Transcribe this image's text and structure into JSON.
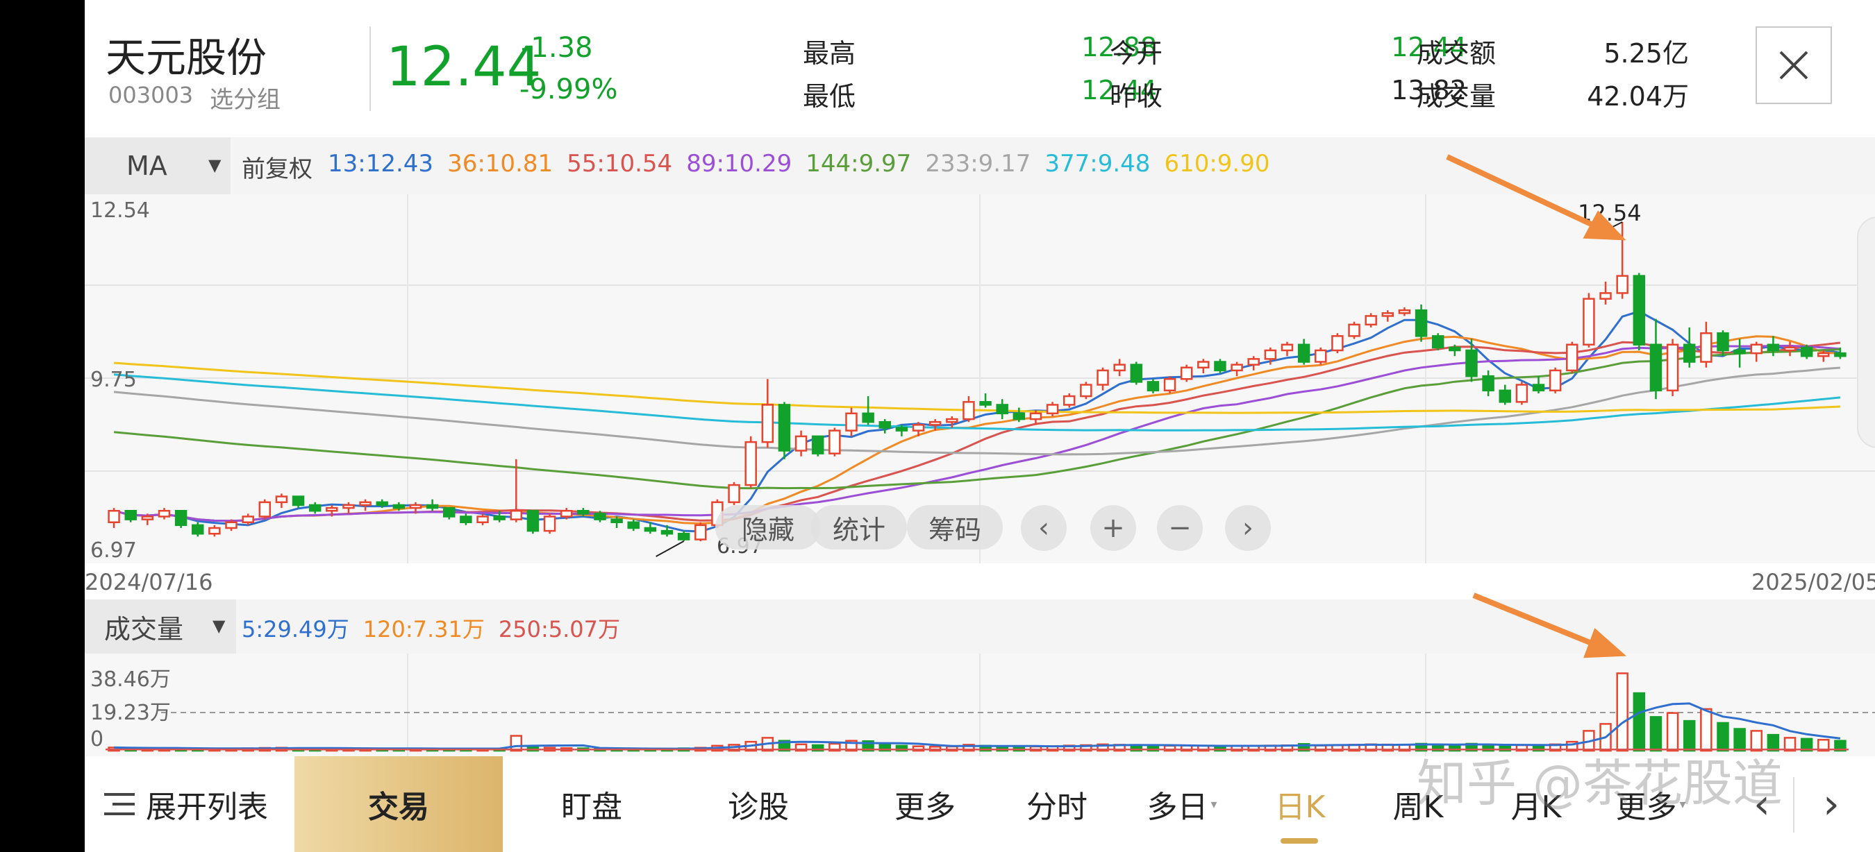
{
  "stock": {
    "name": "天元股份",
    "code": "003003",
    "group_label": "选分组",
    "price": "12.44",
    "change": "-1.38",
    "change_pct": "-9.99%"
  },
  "quote": {
    "high_label": "最高",
    "high": "12.88",
    "low_label": "最低",
    "low": "12.44",
    "open_label": "今开",
    "open": "12.44",
    "prev_close_label": "昨收",
    "prev_close": "13.82",
    "amount_label": "成交额",
    "amount": "5.25亿",
    "volume_label": "成交量",
    "volume": "42.04万"
  },
  "ma_bar": {
    "selector": "MA",
    "adjust": "前复权",
    "items": [
      {
        "text": "13:12.43",
        "color": "#2f6fce"
      },
      {
        "text": "36:10.81",
        "color": "#f08a24"
      },
      {
        "text": "55:10.54",
        "color": "#d9534f"
      },
      {
        "text": "89:10.29",
        "color": "#9b4fd6"
      },
      {
        "text": "144:9.97",
        "color": "#5a9e3a"
      },
      {
        "text": "233:9.17",
        "color": "#a6a6a6"
      },
      {
        "text": "377:9.48",
        "color": "#26bcd7"
      },
      {
        "text": "610:9.90",
        "color": "#f0c419"
      }
    ]
  },
  "price_chart": {
    "y_top": "12.54",
    "y_mid": "9.75",
    "y_bottom": "6.97",
    "max_marker": "12.54",
    "min_marker": "6.97",
    "date_start": "2024/07/16",
    "date_end": "2025/02/05"
  },
  "chart_buttons": {
    "hide": "隐藏",
    "stats": "统计",
    "chips": "筹码",
    "prev": "‹",
    "zoom_in": "+",
    "zoom_out": "−",
    "next": "›"
  },
  "volume_bar": {
    "selector": "成交量",
    "items": [
      {
        "text": "5:29.49万",
        "color": "#2f6fce"
      },
      {
        "text": "120:7.31万",
        "color": "#f08a24"
      },
      {
        "text": "250:5.07万",
        "color": "#d9534f"
      }
    ],
    "y_top": "38.46万",
    "y_mid": "19.23万",
    "y_zero": "0"
  },
  "bottom_bar": {
    "expand_list": "展开列表",
    "trade": "交易",
    "watch": "盯盘",
    "diagnose": "诊股",
    "more": "更多",
    "intraday": "分时",
    "multi_day": "多日",
    "daily_k": "日K",
    "weekly_k": "周K",
    "monthly_k": "月K",
    "more_periods": "更多"
  },
  "watermark": "知乎 @茶花股道",
  "colors": {
    "up": "#e6442e",
    "down": "#12a12a",
    "trade_gold": "#e2c27c",
    "annotation_arrow": "#f08a3c"
  },
  "chart_data": {
    "type": "candlestick",
    "note_source": "estimated from visible candles",
    "ohlc": [
      [
        7.3,
        7.55,
        7.2,
        7.5
      ],
      [
        7.5,
        7.5,
        7.3,
        7.35
      ],
      [
        7.35,
        7.45,
        7.25,
        7.4
      ],
      [
        7.4,
        7.55,
        7.35,
        7.5
      ],
      [
        7.5,
        7.5,
        7.2,
        7.25
      ],
      [
        7.25,
        7.3,
        7.05,
        7.1
      ],
      [
        7.1,
        7.25,
        7.05,
        7.2
      ],
      [
        7.2,
        7.35,
        7.15,
        7.3
      ],
      [
        7.3,
        7.45,
        7.25,
        7.4
      ],
      [
        7.4,
        7.7,
        7.35,
        7.65
      ],
      [
        7.65,
        7.8,
        7.55,
        7.75
      ],
      [
        7.75,
        7.75,
        7.55,
        7.6
      ],
      [
        7.6,
        7.65,
        7.45,
        7.5
      ],
      [
        7.5,
        7.6,
        7.4,
        7.55
      ],
      [
        7.55,
        7.65,
        7.45,
        7.6
      ],
      [
        7.6,
        7.7,
        7.5,
        7.65
      ],
      [
        7.65,
        7.7,
        7.55,
        7.6
      ],
      [
        7.6,
        7.65,
        7.5,
        7.55
      ],
      [
        7.55,
        7.65,
        7.45,
        7.6
      ],
      [
        7.6,
        7.7,
        7.5,
        7.55
      ],
      [
        7.55,
        7.55,
        7.35,
        7.4
      ],
      [
        7.4,
        7.45,
        7.25,
        7.3
      ],
      [
        7.3,
        7.45,
        7.25,
        7.4
      ],
      [
        7.4,
        7.5,
        7.3,
        7.35
      ],
      [
        7.35,
        8.4,
        7.3,
        7.5
      ],
      [
        7.5,
        7.5,
        7.1,
        7.15
      ],
      [
        7.15,
        7.45,
        7.1,
        7.4
      ],
      [
        7.4,
        7.55,
        7.35,
        7.5
      ],
      [
        7.5,
        7.55,
        7.4,
        7.45
      ],
      [
        7.45,
        7.5,
        7.3,
        7.35
      ],
      [
        7.35,
        7.4,
        7.2,
        7.3
      ],
      [
        7.3,
        7.35,
        7.15,
        7.2
      ],
      [
        7.2,
        7.3,
        7.1,
        7.15
      ],
      [
        7.15,
        7.25,
        7.05,
        7.1
      ],
      [
        7.1,
        7.15,
        6.97,
        7.0
      ],
      [
        7.0,
        7.3,
        6.97,
        7.25
      ],
      [
        7.25,
        7.7,
        7.2,
        7.65
      ],
      [
        7.65,
        8.0,
        7.6,
        7.95
      ],
      [
        7.95,
        8.8,
        7.9,
        8.7
      ],
      [
        8.7,
        9.8,
        8.6,
        9.35
      ],
      [
        9.35,
        9.4,
        8.4,
        8.55
      ],
      [
        8.55,
        8.9,
        8.45,
        8.8
      ],
      [
        8.8,
        8.8,
        8.45,
        8.5
      ],
      [
        8.5,
        8.95,
        8.45,
        8.9
      ],
      [
        8.9,
        9.3,
        8.8,
        9.2
      ],
      [
        9.2,
        9.5,
        9.0,
        9.05
      ],
      [
        9.05,
        9.1,
        8.85,
        8.95
      ],
      [
        8.95,
        9.0,
        8.8,
        8.9
      ],
      [
        8.9,
        9.05,
        8.8,
        9.0
      ],
      [
        9.0,
        9.1,
        8.9,
        9.05
      ],
      [
        9.05,
        9.15,
        8.95,
        9.1
      ],
      [
        9.1,
        9.5,
        9.05,
        9.4
      ],
      [
        9.4,
        9.55,
        9.3,
        9.35
      ],
      [
        9.35,
        9.45,
        9.1,
        9.2
      ],
      [
        9.2,
        9.3,
        9.05,
        9.1
      ],
      [
        9.1,
        9.25,
        9.0,
        9.2
      ],
      [
        9.2,
        9.4,
        9.15,
        9.35
      ],
      [
        9.35,
        9.55,
        9.3,
        9.5
      ],
      [
        9.5,
        9.75,
        9.45,
        9.7
      ],
      [
        9.7,
        10.0,
        9.6,
        9.95
      ],
      [
        9.95,
        10.15,
        9.85,
        10.05
      ],
      [
        10.05,
        10.1,
        9.7,
        9.75
      ],
      [
        9.75,
        9.8,
        9.55,
        9.6
      ],
      [
        9.6,
        9.85,
        9.55,
        9.8
      ],
      [
        9.8,
        10.05,
        9.75,
        10.0
      ],
      [
        10.0,
        10.15,
        9.9,
        10.1
      ],
      [
        10.1,
        10.15,
        9.9,
        9.95
      ],
      [
        9.95,
        10.1,
        9.85,
        10.05
      ],
      [
        10.05,
        10.2,
        9.95,
        10.15
      ],
      [
        10.15,
        10.35,
        10.05,
        10.3
      ],
      [
        10.3,
        10.45,
        10.2,
        10.4
      ],
      [
        10.4,
        10.5,
        10.05,
        10.1
      ],
      [
        10.1,
        10.35,
        10.05,
        10.3
      ],
      [
        10.3,
        10.6,
        10.25,
        10.55
      ],
      [
        10.55,
        10.8,
        10.5,
        10.75
      ],
      [
        10.75,
        10.95,
        10.7,
        10.9
      ],
      [
        10.9,
        11.0,
        10.8,
        10.95
      ],
      [
        10.95,
        11.05,
        10.9,
        11.0
      ],
      [
        11.0,
        11.1,
        10.45,
        10.55
      ],
      [
        10.55,
        10.6,
        10.3,
        10.35
      ],
      [
        10.35,
        10.4,
        10.2,
        10.3
      ],
      [
        10.3,
        10.5,
        9.75,
        9.85
      ],
      [
        9.85,
        9.95,
        9.5,
        9.6
      ],
      [
        9.6,
        9.7,
        9.35,
        9.4
      ],
      [
        9.4,
        9.75,
        9.35,
        9.7
      ],
      [
        9.7,
        9.85,
        9.55,
        9.6
      ],
      [
        9.6,
        10.0,
        9.55,
        9.95
      ],
      [
        9.95,
        10.45,
        9.9,
        10.4
      ],
      [
        10.4,
        11.3,
        10.35,
        11.2
      ],
      [
        11.2,
        11.5,
        11.1,
        11.3
      ],
      [
        11.3,
        12.54,
        11.2,
        11.6
      ],
      [
        11.6,
        11.65,
        10.3,
        10.4
      ],
      [
        10.4,
        10.85,
        9.45,
        9.6
      ],
      [
        9.6,
        10.5,
        9.5,
        10.4
      ],
      [
        10.4,
        10.7,
        10.0,
        10.1
      ],
      [
        10.1,
        10.8,
        10.0,
        10.6
      ],
      [
        10.6,
        10.65,
        10.2,
        10.3
      ],
      [
        10.3,
        10.5,
        10.0,
        10.25
      ],
      [
        10.25,
        10.45,
        10.1,
        10.4
      ],
      [
        10.4,
        10.55,
        10.2,
        10.3
      ],
      [
        10.3,
        10.45,
        10.2,
        10.35
      ],
      [
        10.35,
        10.4,
        10.15,
        10.2
      ],
      [
        10.2,
        10.3,
        10.1,
        10.25
      ],
      [
        10.25,
        10.35,
        10.15,
        10.2
      ]
    ],
    "volume": [
      1.6,
      1.4,
      1.2,
      1.3,
      1.2,
      1.1,
      1.0,
      1.1,
      1.2,
      1.4,
      1.5,
      1.3,
      1.2,
      1.1,
      1.2,
      1.2,
      1.1,
      1.0,
      1.1,
      1.1,
      1.0,
      1.0,
      1.1,
      1.0,
      7.5,
      1.8,
      1.5,
      1.3,
      1.2,
      1.1,
      1.0,
      1.0,
      0.9,
      1.0,
      1.2,
      1.5,
      2.5,
      3.0,
      4.5,
      6.5,
      5.0,
      3.2,
      2.8,
      3.5,
      5.0,
      4.8,
      3.0,
      2.5,
      2.2,
      2.0,
      2.1,
      3.0,
      2.5,
      2.2,
      2.0,
      2.1,
      2.3,
      2.6,
      2.8,
      3.2,
      3.0,
      2.8,
      2.4,
      2.5,
      2.6,
      2.5,
      2.3,
      2.4,
      2.5,
      2.6,
      2.7,
      3.4,
      2.6,
      2.8,
      3.0,
      3.2,
      3.1,
      3.0,
      3.5,
      3.0,
      2.8,
      3.5,
      3.0,
      2.6,
      2.8,
      2.6,
      3.2,
      4.5,
      10.0,
      13.5,
      39.0,
      29.0,
      17.0,
      19.0,
      15.0,
      21.0,
      14.0,
      11.0,
      10.0,
      8.0,
      6.5,
      6.0,
      5.5,
      5.0
    ],
    "ma_lines": {
      "13": {
        "color": "#2f6fce"
      },
      "36": {
        "color": "#f08a24"
      },
      "55": {
        "color": "#d9534f"
      },
      "89": {
        "color": "#9b4fd6"
      },
      "144": {
        "color": "#5a9e3a"
      },
      "233": {
        "color": "#a6a6a6"
      },
      "377": {
        "color": "#26bcd7"
      },
      "610": {
        "color": "#f0c419"
      }
    },
    "ylim": [
      6.97,
      12.54
    ],
    "vol_ylim": [
      0,
      38.46
    ]
  }
}
